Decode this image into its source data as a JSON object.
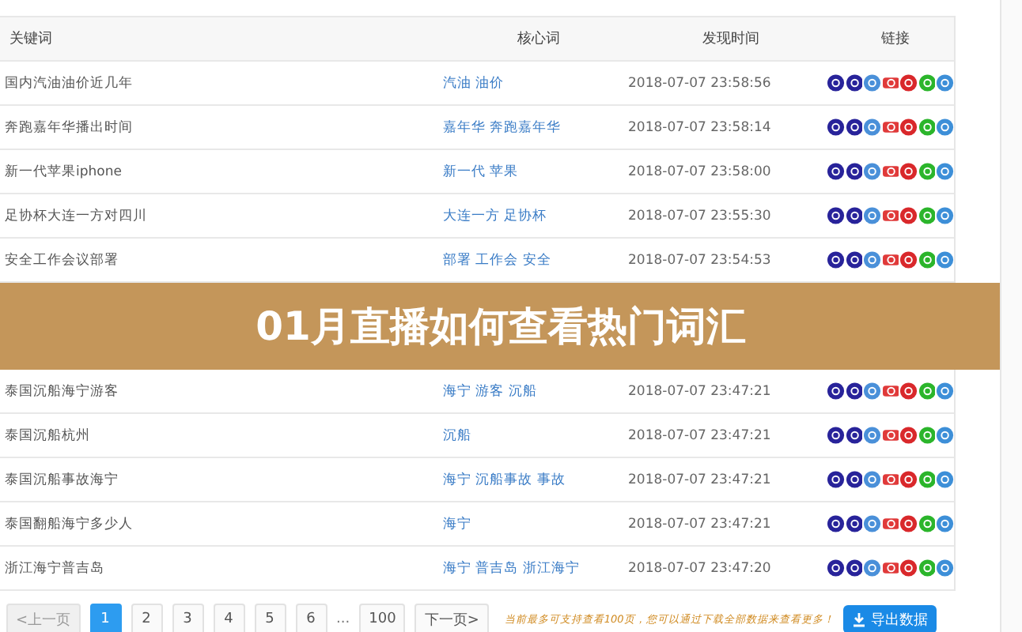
{
  "table": {
    "columns": [
      "关键词",
      "核心词",
      "发现时间",
      "链接"
    ],
    "rows_above": [
      {
        "keyword": "国内汽油油价近几年",
        "core": "汽油 油价",
        "time": "2018-07-07 23:58:56"
      },
      {
        "keyword": "奔跑嘉年华播出时间",
        "core": "嘉年华 奔跑嘉年华",
        "time": "2018-07-07 23:58:14"
      },
      {
        "keyword": "新一代苹果iphone",
        "core": "新一代 苹果",
        "time": "2018-07-07 23:58:00"
      },
      {
        "keyword": "足协杯大连一方对四川",
        "core": "大连一方 足协杯",
        "time": "2018-07-07 23:55:30"
      },
      {
        "keyword": "安全工作会议部署",
        "core": "部署 工作会 安全",
        "time": "2018-07-07 23:54:53"
      }
    ],
    "rows_below": [
      {
        "keyword": "泰国沉船海宁游客",
        "core": "海宁 游客 沉船",
        "time": "2018-07-07 23:47:21"
      },
      {
        "keyword": "泰国沉船杭州",
        "core": "沉船",
        "time": "2018-07-07 23:47:21"
      },
      {
        "keyword": "泰国沉船事故海宁",
        "core": "海宁 沉船事故 事故",
        "time": "2018-07-07 23:47:21"
      },
      {
        "keyword": "泰国翻船海宁多少人",
        "core": "海宁",
        "time": "2018-07-07 23:47:21"
      },
      {
        "keyword": "浙江海宁普吉岛",
        "core": "海宁 普吉岛 浙江海宁",
        "time": "2018-07-07 23:47:20"
      }
    ]
  },
  "banner": "01月直播如何查看热门词汇",
  "pagination": {
    "items": [
      {
        "kind": "page",
        "label": "<上一页",
        "selected": false,
        "disabled": true
      },
      {
        "kind": "page",
        "label": "1",
        "selected": true,
        "disabled": false
      },
      {
        "kind": "page",
        "label": "2",
        "selected": false,
        "disabled": false
      },
      {
        "kind": "page",
        "label": "3",
        "selected": false,
        "disabled": false
      },
      {
        "kind": "page",
        "label": "4",
        "selected": false,
        "disabled": false
      },
      {
        "kind": "page",
        "label": "5",
        "selected": false,
        "disabled": false
      },
      {
        "kind": "page",
        "label": "6",
        "selected": false,
        "disabled": false
      },
      {
        "kind": "ellipsis",
        "label": "..."
      },
      {
        "kind": "page",
        "label": "100",
        "selected": false,
        "disabled": false
      },
      {
        "kind": "page",
        "label": "下一页>",
        "selected": false,
        "disabled": false
      }
    ]
  },
  "notice": "当前最多可支持查看100页，您可以通过下载全部数据来查看更多！",
  "export_button": "导出数据"
}
